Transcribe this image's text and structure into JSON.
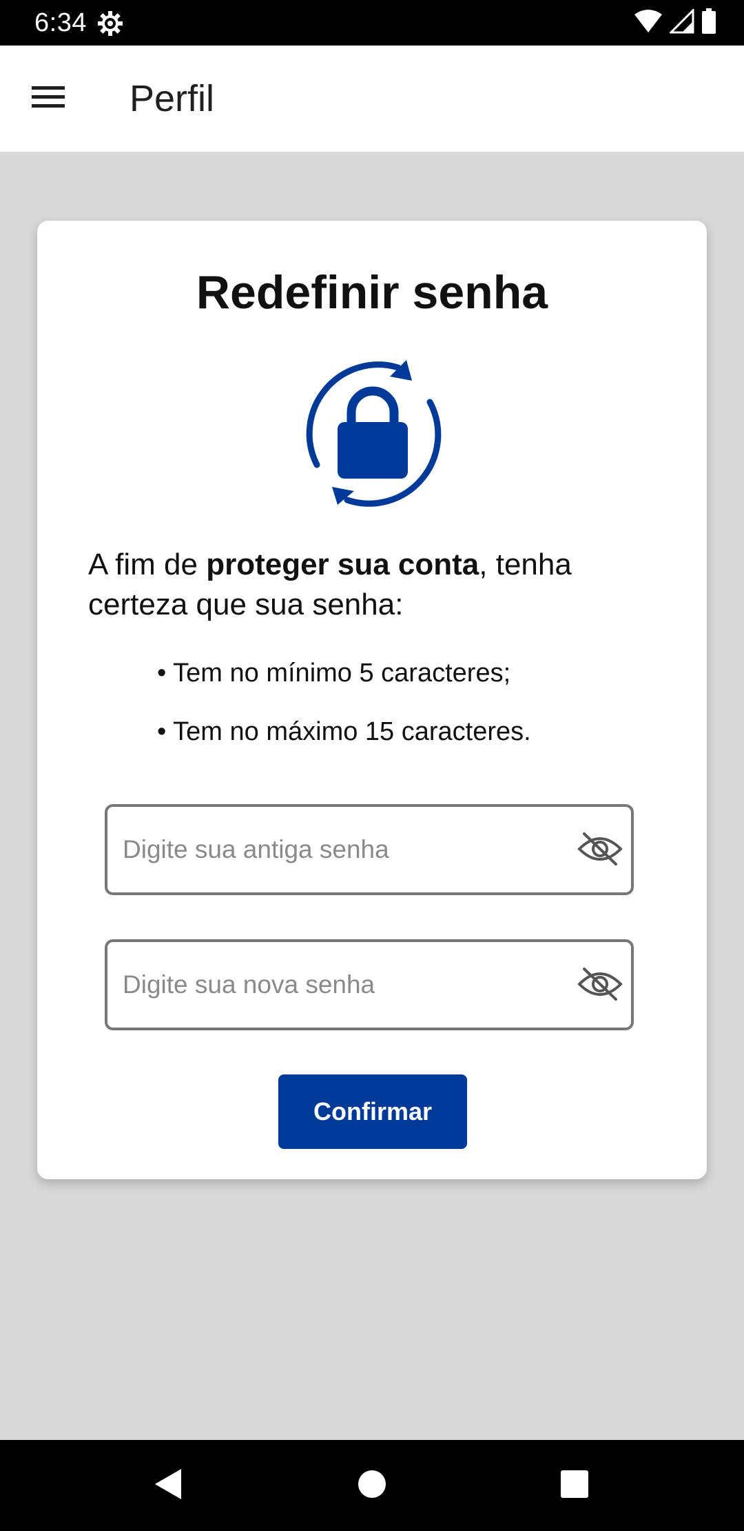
{
  "status_bar": {
    "time": "6:34",
    "icons": [
      "settings-gear-icon",
      "wifi-icon",
      "cell-signal-icon",
      "battery-icon"
    ]
  },
  "app_bar": {
    "menu_icon": "hamburger-menu-icon",
    "title": "Perfil"
  },
  "card": {
    "title": "Redefinir senha",
    "illustration": "lock-refresh-icon",
    "intro_prefix": "A fim de ",
    "intro_bold": "proteger sua conta",
    "intro_suffix": ", tenha certeza que sua senha:",
    "rules": [
      "• Tem no mínimo 5 caracteres;",
      "• Tem no máximo 15 caracteres."
    ],
    "old_password": {
      "value": "",
      "placeholder": "Digite sua antiga senha",
      "toggle_icon": "eye-off-icon"
    },
    "new_password": {
      "value": "",
      "placeholder": "Digite sua nova senha",
      "toggle_icon": "eye-off-icon"
    },
    "confirm_label": "Confirmar"
  },
  "nav_bar": {
    "icons": [
      "back-icon",
      "home-icon",
      "recents-icon"
    ]
  },
  "colors": {
    "brand_blue": "#003a99",
    "background": "#d9d9d9",
    "card": "#ffffff",
    "status_bar": "#000000"
  }
}
